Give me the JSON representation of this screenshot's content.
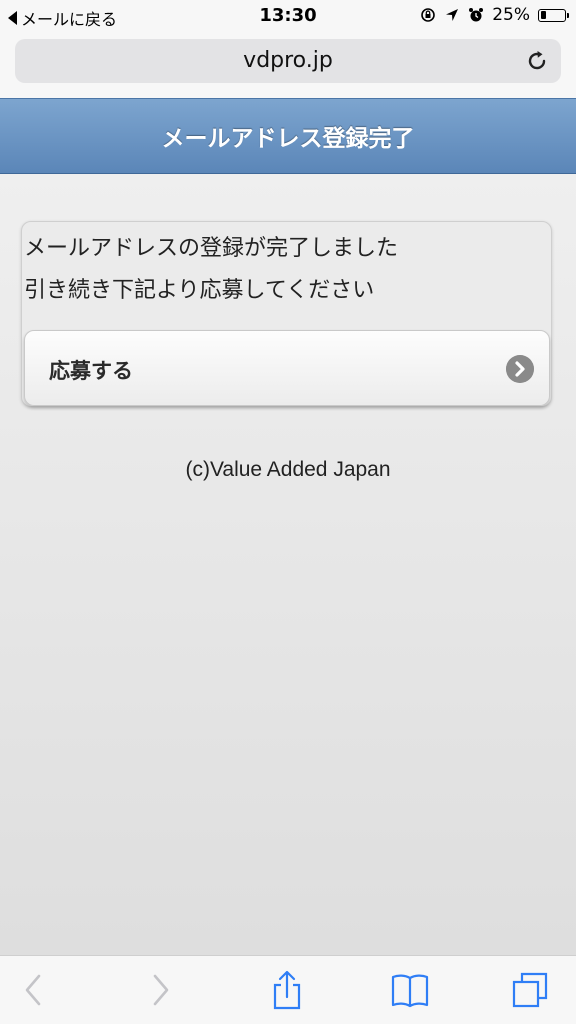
{
  "status_bar": {
    "back_label": "メールに戻る",
    "time": "13:30",
    "battery": "25%",
    "battery_level": 0.25
  },
  "browser": {
    "url": "vdpro.jp"
  },
  "header": {
    "title": "メールアドレス登録完了"
  },
  "card": {
    "message_line1": "メールアドレスの登録が完了しました",
    "message_line2": "引き続き下記より応募してください",
    "button_label": "応募する"
  },
  "footer": {
    "copyright": "(c)Value Added Japan"
  },
  "colors": {
    "header_top": "#7da5cf",
    "header_bottom": "#5b86b8",
    "ios_blue": "#2f7ef6"
  },
  "toolbar": {
    "icons": [
      "back-icon",
      "forward-icon",
      "share-icon",
      "bookmarks-icon",
      "tabs-icon"
    ]
  }
}
